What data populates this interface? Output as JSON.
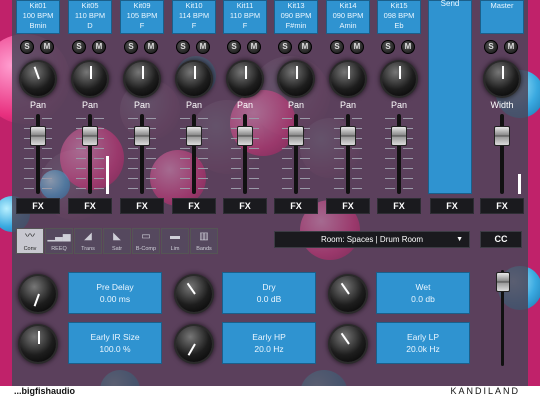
{
  "strips": [
    {
      "kit": "Kit01",
      "bpm": "100 BPM",
      "key": "Bmin",
      "knob_label": "Pan",
      "fx_label": "FX"
    },
    {
      "kit": "Kit05",
      "bpm": "110 BPM",
      "key": "D",
      "knob_label": "Pan",
      "fx_label": "FX"
    },
    {
      "kit": "Kit09",
      "bpm": "105 BPM",
      "key": "F",
      "knob_label": "Pan",
      "fx_label": "FX"
    },
    {
      "kit": "Kit10",
      "bpm": "114 BPM",
      "key": "F",
      "knob_label": "Pan",
      "fx_label": "FX"
    },
    {
      "kit": "Kit11",
      "bpm": "110 BPM",
      "key": "F",
      "knob_label": "Pan",
      "fx_label": "FX"
    },
    {
      "kit": "Kit13",
      "bpm": "090 BPM",
      "key": "F#min",
      "knob_label": "Pan",
      "fx_label": "FX"
    },
    {
      "kit": "Kit14",
      "bpm": "090 BPM",
      "key": "Amin",
      "knob_label": "Pan",
      "fx_label": "FX"
    },
    {
      "kit": "Kit15",
      "bpm": "098 BPM",
      "key": "Eb",
      "knob_label": "Pan",
      "fx_label": "FX"
    }
  ],
  "solo_label": "S",
  "mute_label": "M",
  "send": {
    "label": "Send",
    "fx_label": "FX"
  },
  "master": {
    "label": "Master",
    "knob_label": "Width",
    "fx_label": "FX"
  },
  "modes": [
    {
      "label": "Conv",
      "active": true
    },
    {
      "label": "REEQ",
      "active": false
    },
    {
      "label": "Trans",
      "active": false
    },
    {
      "label": "Satr",
      "active": false
    },
    {
      "label": "B-Comp",
      "active": false
    },
    {
      "label": "Lim",
      "active": false
    },
    {
      "label": "Bands",
      "active": false
    }
  ],
  "room_select": {
    "value": "Room: Spaces | Drum Room"
  },
  "cc_label": "CC",
  "params": [
    {
      "name": "Pre Delay",
      "value": "0.00 ms"
    },
    {
      "name": "Dry",
      "value": "0.0 dB"
    },
    {
      "name": "Wet",
      "value": "0.0 db"
    },
    {
      "name": "Early IR Size",
      "value": "100.0 %"
    },
    {
      "name": "Early HP",
      "value": "20.0 Hz"
    },
    {
      "name": "Early LP",
      "value": "20.0k Hz"
    }
  ],
  "footer": {
    "left": "...bigfishaudio",
    "right": "KANDILAND"
  },
  "colors": {
    "accent": "#2f93d0",
    "background": "#c0226a",
    "panel": "#4b465a"
  }
}
